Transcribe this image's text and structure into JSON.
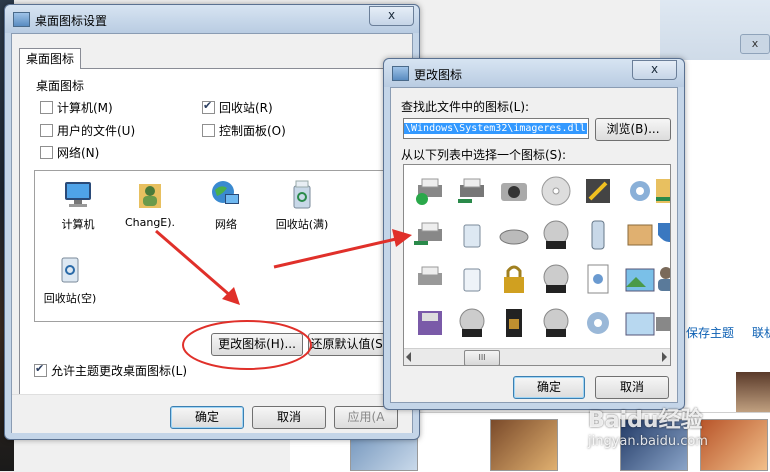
{
  "desktop_icon_settings": {
    "title": "桌面图标设置",
    "close": "x",
    "tab": "桌面图标",
    "group_label": "桌面图标",
    "checkboxes": [
      {
        "label": "计算机(M)",
        "checked": false
      },
      {
        "label": "回收站(R)",
        "checked": true
      },
      {
        "label": "用户的文件(U)",
        "checked": false
      },
      {
        "label": "控制面板(O)",
        "checked": false
      },
      {
        "label": "网络(N)",
        "checked": false
      }
    ],
    "icons": [
      {
        "label": "计算机",
        "icon": "computer-icon"
      },
      {
        "label": "ChangE).",
        "icon": "user-folder-icon"
      },
      {
        "label": "网络",
        "icon": "network-icon"
      },
      {
        "label": "回收站(满)",
        "icon": "recycle-bin-full-icon"
      },
      {
        "label": "回收站(空)",
        "icon": "recycle-bin-empty-icon"
      }
    ],
    "change_icon_button": "更改图标(H)...",
    "restore_default_button": "还原默认值(S)",
    "allow_theme_label": "允许主题更改桌面图标(L)",
    "allow_theme_checked": true,
    "ok_button": "确定",
    "cancel_button": "取消",
    "apply_button": "应用(A"
  },
  "change_icon_dialog": {
    "title": "更改图标",
    "close": "x",
    "find_label": "查找此文件中的图标(L):",
    "path_value": "\\Windows\\System32\\imageres.dll",
    "browse_button": "浏览(B)...",
    "select_label": "从以下列表中选择一个图标(S):",
    "scroll_thumb": "III",
    "ok_button": "确定",
    "cancel_button": "取消"
  },
  "background": {
    "save_theme_link": "保存主题",
    "online_link": "联机",
    "close_far": "x",
    "watermark": "Baidu经验",
    "watermark_url": "jingyan.baidu.com"
  },
  "colors": {
    "accent": "#3399ff",
    "arrow": "#e0302a",
    "link": "#0b5fb3"
  }
}
